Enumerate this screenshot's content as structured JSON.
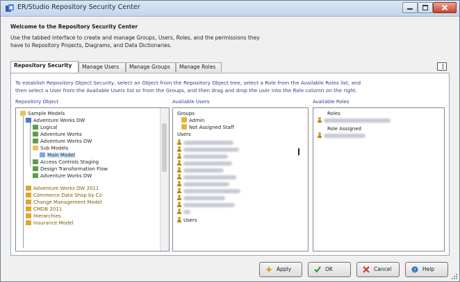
{
  "window": {
    "title": "ER/Studio Repository Security Center",
    "controls": [
      "minimize",
      "maximize",
      "close"
    ]
  },
  "intro": {
    "heading": "Welcome to the Repository Security Center",
    "line1": "Use the tabbed interface to create and manage Groups, Users, Roles, and the permissions they",
    "line2": "have to Repository Projects, Diagrams, and Data Dictionaries."
  },
  "tabs": [
    {
      "label": "Repository Security",
      "active": true
    },
    {
      "label": "Manage Users",
      "active": false
    },
    {
      "label": "Manage Groups",
      "active": false
    },
    {
      "label": "Manage Roles",
      "active": false
    }
  ],
  "description": {
    "line1": "To establish Repository Object Security, select an Object from the Repository Object tree, select a Role from the Available Roles list, and",
    "line2": "then select a User from the Available Users list or from the Groups, and then drag and drop the user into the Role column on the right."
  },
  "columns": {
    "objects_label": "Repository Object",
    "users_label": "Available Users",
    "roles_label": "Available Roles"
  },
  "tree": [
    {
      "label": "Sample Models",
      "level": 0,
      "icon": "folder-icon"
    },
    {
      "label": "Adventure Works DW",
      "level": 1,
      "icon": "diagram-icon"
    },
    {
      "label": "Logical",
      "level": 2,
      "icon": "model-icon"
    },
    {
      "label": "Adventure Works",
      "level": 2,
      "icon": "model-icon"
    },
    {
      "label": "Adventure Works DW",
      "level": 2,
      "icon": "model-icon"
    },
    {
      "label": "Sub Models",
      "level": 2,
      "icon": "folder-icon"
    },
    {
      "label": "Main Model",
      "level": 3,
      "icon": "submodel-icon",
      "selected": true
    },
    {
      "label": "Access Controls Staging",
      "level": 2,
      "icon": "model-icon"
    },
    {
      "label": "Design Transformation Flow",
      "level": 2,
      "icon": "model-icon"
    },
    {
      "label": "Adventure Works DW",
      "level": 2,
      "icon": "model-icon"
    },
    {
      "label": "Adventure Works DW 2011",
      "level": 1,
      "icon": "diagram-icon",
      "yellow": true
    },
    {
      "label": "Commerce Data Shop by Co",
      "level": 1,
      "icon": "diagram-icon",
      "yellow": true
    },
    {
      "label": "Change Management Model",
      "level": 1,
      "icon": "diagram-icon",
      "yellow": true
    },
    {
      "label": "CMDB 2011",
      "level": 1,
      "icon": "diagram-icon",
      "yellow": true
    },
    {
      "label": "Hierarchies",
      "level": 1,
      "icon": "diagram-icon",
      "yellow": true
    },
    {
      "label": "Insurance Model",
      "level": 1,
      "icon": "diagram-icon",
      "yellow": true
    }
  ],
  "users": {
    "groups_header": "Groups",
    "groups": [
      "Admin",
      "Not Assigned Staff"
    ],
    "users_header": "Users",
    "user_count": 11,
    "footer": "Users"
  },
  "roles": {
    "header": "Roles",
    "assigned_header": "Role Assigned",
    "roles_count": 1,
    "assigned_count": 1
  },
  "buttons": [
    {
      "label": "Apply",
      "icon": "apply-icon"
    },
    {
      "label": "OK",
      "icon": "check-icon"
    },
    {
      "label": "Cancel",
      "icon": "cancel-icon"
    },
    {
      "label": "Help",
      "icon": "help-icon"
    }
  ],
  "colors": {
    "accent_text": "#2e3d8c",
    "title_bar": "#c4d5ea",
    "close_button": "#c7442d"
  }
}
